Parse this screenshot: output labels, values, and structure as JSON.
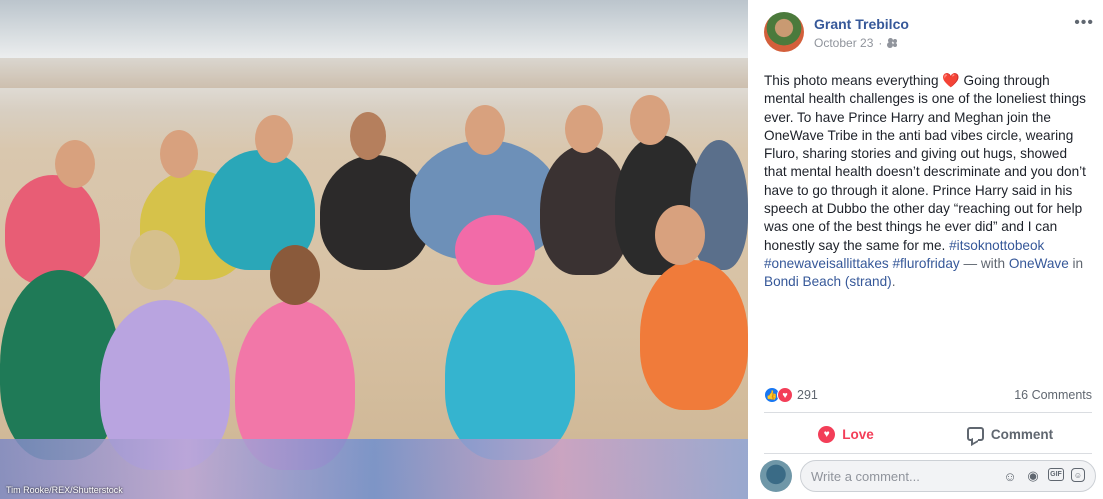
{
  "photo": {
    "credit": "Tim Rooke/REX/Shutterstock"
  },
  "post": {
    "author": "Grant Trebilco",
    "date": "October 23",
    "privacy_icon": "friends-icon",
    "more_label": "•••",
    "text_part1": "This photo means everything ",
    "heart_emoji": "❤️",
    "text_part2": " Going through mental health challenges is one of the loneliest things ever. To have Prince Harry and Meghan join the OneWave Tribe in the anti bad vibes circle, wearing Fluro, sharing stories and giving out hugs, showed that mental health doesn’t descriminate and you don’t have to go through it alone. Prince Harry said in his speech at Dubbo the other day “reaching out for help was one of the best things he ever did” and I can honestly say the same for me. ",
    "hashtags": "#itsoknottobeok #onewaveisallittakes #flurofriday",
    "with_text": " — with ",
    "tagged_page": "OneWave",
    "in_text": " in ",
    "location": "Bondi Beach (strand)",
    "end_text": "."
  },
  "reactions": {
    "count": "291",
    "comments": "16 Comments"
  },
  "actions": {
    "love_label": "Love",
    "comment_label": "Comment"
  },
  "comment_box": {
    "placeholder": "Write a comment...",
    "icons": [
      "emoji-icon",
      "camera-icon",
      "gif-icon",
      "sticker-icon"
    ]
  },
  "colors": {
    "link": "#365899",
    "love": "#f33e58",
    "like": "#1877f2"
  }
}
